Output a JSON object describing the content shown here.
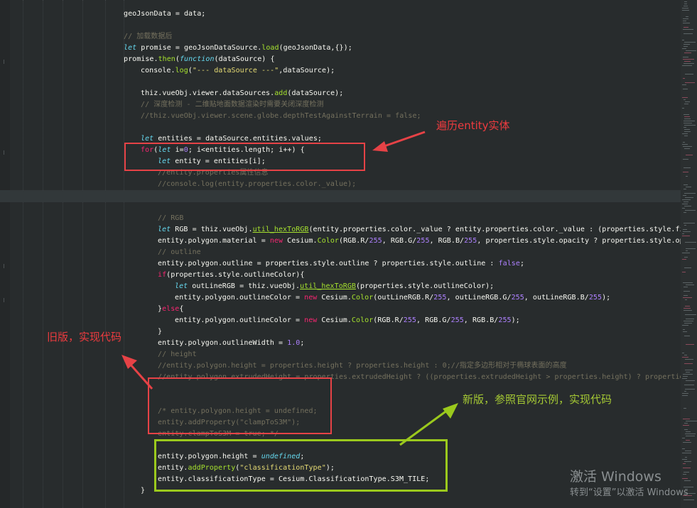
{
  "code_lines": [
    [
      {
        "t": "geoJsonData = data;",
        "c": "p"
      }
    ],
    [],
    [
      {
        "t": "// 加载数据后",
        "c": "c"
      }
    ],
    [
      {
        "t": "let",
        "c": "k"
      },
      {
        "t": " promise = geoJsonDataSource.",
        "c": "p"
      },
      {
        "t": "load",
        "c": "f"
      },
      {
        "t": "(geoJsonData,{});",
        "c": "p"
      }
    ],
    [
      {
        "t": "promise.",
        "c": "p"
      },
      {
        "t": "then",
        "c": "f"
      },
      {
        "t": "(",
        "c": "p"
      },
      {
        "t": "function",
        "c": "k"
      },
      {
        "t": "(dataSource) {",
        "c": "p"
      }
    ],
    [
      {
        "t": "console.",
        "c": "p"
      },
      {
        "t": "log",
        "c": "f"
      },
      {
        "t": "(",
        "c": "p"
      },
      {
        "t": "\"--- dataSource ---\"",
        "c": "s"
      },
      {
        "t": ",dataSource);",
        "c": "p"
      }
    ],
    [],
    [
      {
        "t": "thiz.vueObj.viewer.dataSources.",
        "c": "p"
      },
      {
        "t": "add",
        "c": "f"
      },
      {
        "t": "(dataSource);",
        "c": "p"
      }
    ],
    [
      {
        "t": "// 深度检测 - 二维贴地面数据渲染时需要关闭深度检测",
        "c": "c"
      }
    ],
    [
      {
        "t": "//thiz.vueObj.viewer.scene.globe.depthTestAgainstTerrain = false;",
        "c": "c"
      }
    ],
    [],
    [
      {
        "t": "let",
        "c": "k"
      },
      {
        "t": " entities = dataSource.entities.values;",
        "c": "p"
      }
    ],
    [
      {
        "t": "for",
        "c": "r"
      },
      {
        "t": "(",
        "c": "p"
      },
      {
        "t": "let",
        "c": "k"
      },
      {
        "t": " i=",
        "c": "p"
      },
      {
        "t": "0",
        "c": "n"
      },
      {
        "t": "; i<entities.length; i++) {",
        "c": "p"
      }
    ],
    [
      {
        "t": "let",
        "c": "k"
      },
      {
        "t": " entity = entities[i];",
        "c": "p"
      }
    ],
    [
      {
        "t": "//entity.properties属性信息",
        "c": "c"
      }
    ],
    [
      {
        "t": "//console.log(entity.properties.color._value);",
        "c": "c"
      }
    ],
    [],
    [],
    [
      {
        "t": "// RGB",
        "c": "c"
      }
    ],
    [
      {
        "t": "let",
        "c": "k"
      },
      {
        "t": " RGB = thiz.vueObj.",
        "c": "p"
      },
      {
        "t": "util_hexToRGB",
        "c": "fu"
      },
      {
        "t": "(entity.properties.color._value ? entity.properties.color._value : (properties.style.fil",
        "c": "p"
      }
    ],
    [
      {
        "t": "entity.polygon.material = ",
        "c": "p"
      },
      {
        "t": "new",
        "c": "r"
      },
      {
        "t": " Cesium.",
        "c": "p"
      },
      {
        "t": "Color",
        "c": "f"
      },
      {
        "t": "(RGB.R/",
        "c": "p"
      },
      {
        "t": "255",
        "c": "n"
      },
      {
        "t": ", RGB.G/",
        "c": "p"
      },
      {
        "t": "255",
        "c": "n"
      },
      {
        "t": ", RGB.B/",
        "c": "p"
      },
      {
        "t": "255",
        "c": "n"
      },
      {
        "t": ", properties.style.opacity ? properties.style.opa",
        "c": "p"
      }
    ],
    [
      {
        "t": "// outline",
        "c": "c"
      }
    ],
    [
      {
        "t": "entity.polygon.outline = properties.style.outline ? properties.style.outline : ",
        "c": "p"
      },
      {
        "t": "false",
        "c": "n"
      },
      {
        "t": ";",
        "c": "p"
      }
    ],
    [
      {
        "t": "if",
        "c": "r"
      },
      {
        "t": "(properties.style.outlineColor){",
        "c": "p"
      }
    ],
    [
      {
        "t": "let",
        "c": "k"
      },
      {
        "t": " outLineRGB = thiz.vueObj.",
        "c": "p"
      },
      {
        "t": "util_hexToRGB",
        "c": "fu"
      },
      {
        "t": "(properties.style.outlineColor);",
        "c": "p"
      }
    ],
    [
      {
        "t": "entity.polygon.outlineColor = ",
        "c": "p"
      },
      {
        "t": "new",
        "c": "r"
      },
      {
        "t": " Cesium.",
        "c": "p"
      },
      {
        "t": "Color",
        "c": "f"
      },
      {
        "t": "(outLineRGB.R/",
        "c": "p"
      },
      {
        "t": "255",
        "c": "n"
      },
      {
        "t": ", outLineRGB.G/",
        "c": "p"
      },
      {
        "t": "255",
        "c": "n"
      },
      {
        "t": ", outLineRGB.B/",
        "c": "p"
      },
      {
        "t": "255",
        "c": "n"
      },
      {
        "t": ");",
        "c": "p"
      }
    ],
    [
      {
        "t": "}",
        "c": "p"
      },
      {
        "t": "else",
        "c": "r"
      },
      {
        "t": "{",
        "c": "p"
      }
    ],
    [
      {
        "t": "entity.polygon.outlineColor = ",
        "c": "p"
      },
      {
        "t": "new",
        "c": "r"
      },
      {
        "t": " Cesium.",
        "c": "p"
      },
      {
        "t": "Color",
        "c": "f"
      },
      {
        "t": "(RGB.R/",
        "c": "p"
      },
      {
        "t": "255",
        "c": "n"
      },
      {
        "t": ", RGB.G/",
        "c": "p"
      },
      {
        "t": "255",
        "c": "n"
      },
      {
        "t": ", RGB.B/",
        "c": "p"
      },
      {
        "t": "255",
        "c": "n"
      },
      {
        "t": ");",
        "c": "p"
      }
    ],
    [
      {
        "t": "}",
        "c": "p"
      }
    ],
    [
      {
        "t": "entity.polygon.outlineWidth = ",
        "c": "p"
      },
      {
        "t": "1.0",
        "c": "n"
      },
      {
        "t": ";",
        "c": "p"
      }
    ],
    [
      {
        "t": "// height",
        "c": "c"
      }
    ],
    [
      {
        "t": "//entity.polygon.height = properties.height ? properties.height : 0;//指定多边形相对于椭球表面的高度",
        "c": "c"
      }
    ],
    [
      {
        "t": "//entity.polygon.extrudedHeight = properties.extrudedHeight ? ((properties.extrudedHeight > properties.height) ? properties",
        "c": "c"
      }
    ],
    [],
    [],
    [
      {
        "t": "/* entity.polygon.height = undefined;",
        "c": "c"
      }
    ],
    [
      {
        "t": "entity.addProperty(\"clampToS3M\");",
        "c": "c"
      }
    ],
    [
      {
        "t": "entity.clampToS3M = true; */",
        "c": "c"
      }
    ],
    [],
    [
      {
        "t": "entity.polygon.height = ",
        "c": "p"
      },
      {
        "t": "undefined",
        "c": "k"
      },
      {
        "t": ";",
        "c": "p"
      }
    ],
    [
      {
        "t": "entity.",
        "c": "p"
      },
      {
        "t": "addProperty",
        "c": "f"
      },
      {
        "t": "(",
        "c": "p"
      },
      {
        "t": "\"classificationType\"",
        "c": "s"
      },
      {
        "t": ");",
        "c": "p"
      }
    ],
    [
      {
        "t": "entity.classificationType = Cesium.ClassificationType.S3M_TILE;",
        "c": "p"
      }
    ],
    [
      {
        "t": "}",
        "c": "p"
      }
    ]
  ],
  "annotations": {
    "traverse": "遍历entity实体",
    "old_version": "旧版，实现代码",
    "new_version": "新版，参照官网示例，实现代码"
  },
  "watermark": {
    "line1": "激活 Windows",
    "line2": "转到“设置”以激活 Windows"
  },
  "colors": {
    "annotation_red": "#ee3b3f",
    "annotation_green": "#a5c934"
  }
}
